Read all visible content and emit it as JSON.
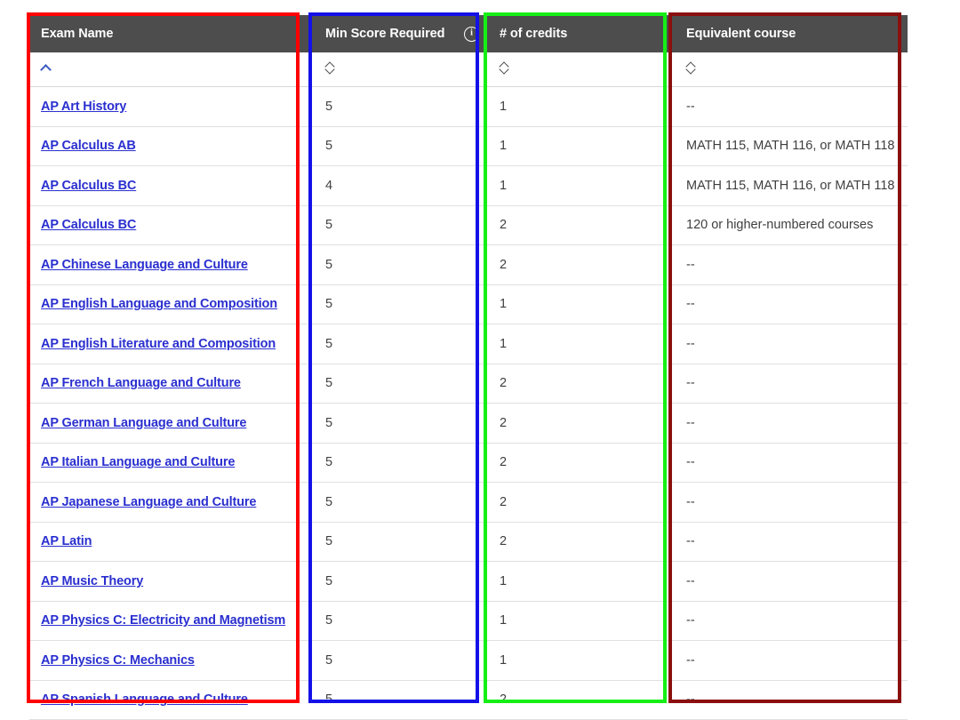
{
  "table": {
    "columns": [
      {
        "key": "exam_name",
        "label": "Exam Name",
        "has_info_icon": false,
        "sort_state": "ascending"
      },
      {
        "key": "min_score",
        "label": "Min Score Required",
        "has_info_icon": true,
        "sort_state": "unsorted"
      },
      {
        "key": "credits",
        "label": "# of credits",
        "has_info_icon": false,
        "sort_state": "unsorted"
      },
      {
        "key": "equiv_course",
        "label": "Equivalent course",
        "has_info_icon": false,
        "sort_state": "unsorted"
      }
    ],
    "rows": [
      {
        "exam_name": "AP Art History",
        "min_score": "5",
        "credits": "1",
        "equiv_course": "--"
      },
      {
        "exam_name": "AP Calculus AB",
        "min_score": "5",
        "credits": "1",
        "equiv_course": "MATH 115, MATH 116, or MATH 118"
      },
      {
        "exam_name": "AP Calculus BC",
        "min_score": "4",
        "credits": "1",
        "equiv_course": "MATH 115, MATH 116, or MATH 118"
      },
      {
        "exam_name": "AP Calculus BC",
        "min_score": "5",
        "credits": "2",
        "equiv_course": "120 or higher-numbered courses"
      },
      {
        "exam_name": "AP Chinese Language and Culture",
        "min_score": "5",
        "credits": "2",
        "equiv_course": "--"
      },
      {
        "exam_name": "AP English Language and Composition",
        "min_score": "5",
        "credits": "1",
        "equiv_course": "--"
      },
      {
        "exam_name": "AP English Literature and Composition",
        "min_score": "5",
        "credits": "1",
        "equiv_course": "--"
      },
      {
        "exam_name": "AP French Language and Culture",
        "min_score": "5",
        "credits": "2",
        "equiv_course": "--"
      },
      {
        "exam_name": "AP German Language and Culture",
        "min_score": "5",
        "credits": "2",
        "equiv_course": "--"
      },
      {
        "exam_name": "AP Italian Language and Culture",
        "min_score": "5",
        "credits": "2",
        "equiv_course": "--"
      },
      {
        "exam_name": "AP Japanese Language and Culture",
        "min_score": "5",
        "credits": "2",
        "equiv_course": "--"
      },
      {
        "exam_name": "AP Latin",
        "min_score": "5",
        "credits": "2",
        "equiv_course": "--"
      },
      {
        "exam_name": "AP Music Theory",
        "min_score": "5",
        "credits": "1",
        "equiv_course": "--"
      },
      {
        "exam_name": "AP Physics C: Electricity and Magnetism",
        "min_score": "5",
        "credits": "1",
        "equiv_course": "--"
      },
      {
        "exam_name": "AP Physics C: Mechanics",
        "min_score": "5",
        "credits": "1",
        "equiv_course": "--"
      },
      {
        "exam_name": "AP Spanish Language and Culture",
        "min_score": "5",
        "credits": "2",
        "equiv_course": "--"
      }
    ]
  },
  "icons": {
    "info": "info-circle-icon",
    "sort_ascending": "chevron-up-icon",
    "sort_unsorted": "sort-diamond-icon"
  },
  "annotations": [
    {
      "name": "exam-name-column-highlight",
      "color": "#fe0000",
      "target": "Exam Name"
    },
    {
      "name": "min-score-column-highlight",
      "color": "#1311e8",
      "target": "Min Score Required"
    },
    {
      "name": "credits-column-highlight",
      "color": "#16ef16",
      "target": "# of credits"
    },
    {
      "name": "equivalent-course-column-highlight",
      "color": "#8b0f0f",
      "target": "Equivalent course"
    }
  ]
}
